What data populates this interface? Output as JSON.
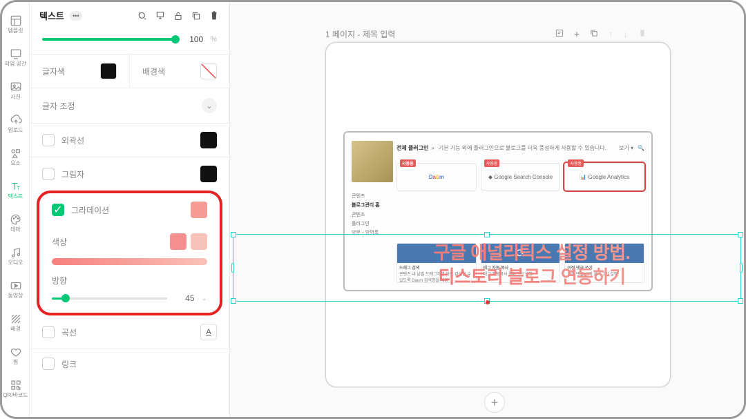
{
  "rail": [
    {
      "label": "템플릿",
      "icon": "layout"
    },
    {
      "label": "작업 공간",
      "icon": "workspace"
    },
    {
      "label": "사진",
      "icon": "photo"
    },
    {
      "label": "업로드",
      "icon": "upload"
    },
    {
      "label": "요소",
      "icon": "element"
    },
    {
      "label": "텍스트",
      "icon": "text",
      "active": true
    },
    {
      "label": "테마",
      "icon": "palette"
    },
    {
      "label": "오디오",
      "icon": "audio"
    },
    {
      "label": "동영상",
      "icon": "video"
    },
    {
      "label": "배경",
      "icon": "background"
    },
    {
      "label": "찜",
      "icon": "heart"
    },
    {
      "label": "QR/바코드",
      "icon": "qr"
    }
  ],
  "panel": {
    "title": "텍스트",
    "opacity": {
      "value": 100,
      "unit": "%"
    },
    "textColor": {
      "label": "글자색",
      "value": "#111111"
    },
    "bgColor": {
      "label": "배경색",
      "value": "none"
    },
    "adjust": {
      "label": "글자 조정"
    },
    "options": {
      "outline": {
        "label": "외곽선",
        "checked": false,
        "swatch": "#111111"
      },
      "shadow": {
        "label": "그림자",
        "checked": false,
        "swatch": "#111111"
      },
      "gradient": {
        "label": "그라데이션",
        "checked": true,
        "swatch": "#f69b94"
      },
      "curve": {
        "label": "곡선",
        "checked": false
      },
      "link": {
        "label": "링크",
        "checked": false
      }
    },
    "gradient": {
      "colorsLabel": "색상",
      "stops": [
        "#f48f8f",
        "#f7c3b8"
      ],
      "directionLabel": "방향",
      "direction": 45
    }
  },
  "canvas": {
    "pageIndex": "1 페이지",
    "pageTitlePlaceholder": "제목 입력",
    "overlay": {
      "line1": "구글 애널리틱스 설정 방법.",
      "line2": "티스토리 블로그 연동하기"
    },
    "inner": {
      "headTitle": "전체 플러그인",
      "headArrow": "»",
      "headDesc": "기본 기능 외에 플러그인으로 블로그를 더욱 풍성하게 사용할 수 있습니다.",
      "viewLabel": "보기 ▾",
      "tag": "사용중",
      "services": [
        {
          "name": "Daum"
        },
        {
          "name": "Google Search Console"
        },
        {
          "name": "Google Analytics"
        }
      ],
      "leftNav": [
        "콘텐츠",
        "블로그관리 홈",
        "콘텐츠",
        "플러그인",
        "방문・방명록"
      ],
      "cards": [
        {
          "title": "드래그 검색",
          "desc": "콘텐츠 내 낱말 드래그하면 바로 검색할 수 있도록 Daum 검색창을 제공"
        },
        {
          "title": "태그 자동 복사",
          "desc": "태그 자동복사 플러그인 설명"
        },
        {
          "title": "이전 댓글 쓰기",
          "desc": "이전 댓글 쓰기 플러그인 설명"
        }
      ]
    }
  }
}
